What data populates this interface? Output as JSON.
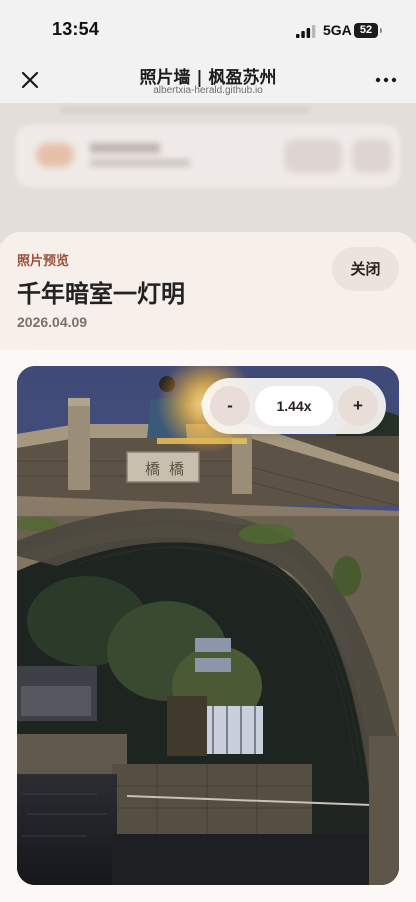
{
  "status_bar": {
    "time": "13:54",
    "network": "5GA",
    "battery": "52"
  },
  "nav": {
    "title": "照片墙 | 枫盈苏州",
    "url": "albertxia-herald.github.io",
    "close_icon": "close-icon",
    "more_icon": "more-icon"
  },
  "modal": {
    "eyebrow": "照片预览",
    "title": "千年暗室一灯明",
    "date": "2026.04.09",
    "close_label": "关闭",
    "zoom": {
      "decrease_label": "-",
      "value": "1.44x",
      "increase_label": "+"
    }
  },
  "colors": {
    "accent": "#9c4f3a",
    "sheet_background": "#fbf8f6",
    "button_background": "#ede3dd"
  }
}
